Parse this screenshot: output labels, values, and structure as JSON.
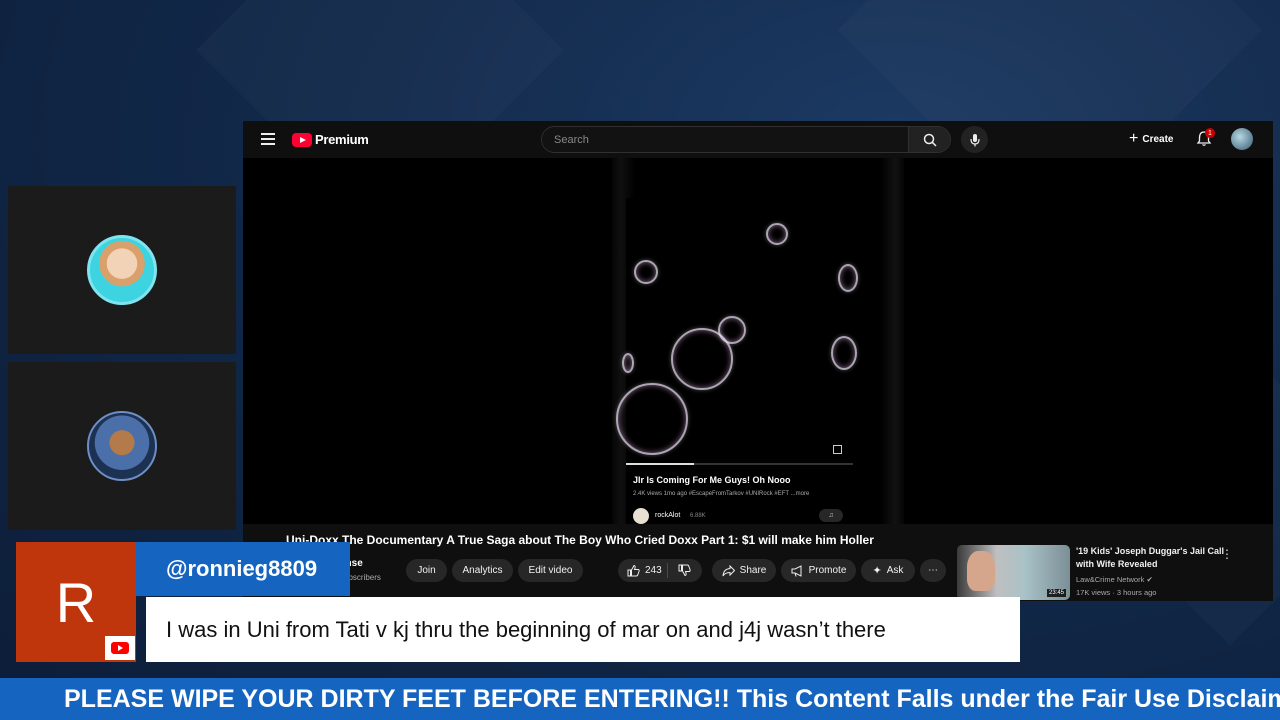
{
  "youtube": {
    "logo_text": "Premium",
    "search_placeholder": "Search",
    "create_label": "Create",
    "notification_count": "1",
    "video_title": "Uni-Doxx The Documentary A True Saga about The Boy Who Cried Doxx Part 1: $1 will make him Holler",
    "channel_name_partial": "ense",
    "channel_subs_partial": "subscribers",
    "buttons": {
      "join": "Join",
      "analytics": "Analytics",
      "edit_video": "Edit video",
      "like_count": "243",
      "share": "Share",
      "promote": "Promote",
      "ask": "Ask"
    },
    "short": {
      "title": "Jlr Is Coming For Me Guys! Oh Nooo",
      "meta": "2.4K views  1mo ago  #EscapeFromTarkov #UNIRock #EFT  ...more",
      "channel": "rockAlot",
      "subs": "6.88K"
    },
    "recommended": {
      "title": "'19 Kids' Joseph Duggar's Jail Call with Wife Revealed",
      "channel": "Law&Crime Network",
      "meta": "17K views · 3 hours ago",
      "duration": "23:45"
    }
  },
  "chat": {
    "avatar_letter": "R",
    "username": "@ronnieg8809",
    "message": "I was in Uni from Tati v kj thru the beginning of mar on and j4j wasn’t there"
  },
  "ticker": {
    "text": "PLEASE WIPE YOUR DIRTY FEET BEFORE ENTERING!! This Content Falls under the Fair Use Disclaim"
  },
  "colors": {
    "background": "#12294a",
    "brand_red": "#ff0033",
    "chat_user_bg": "#1565c0",
    "chat_avatar_bg": "#bf360c",
    "ticker_bg": "#1565c0"
  }
}
